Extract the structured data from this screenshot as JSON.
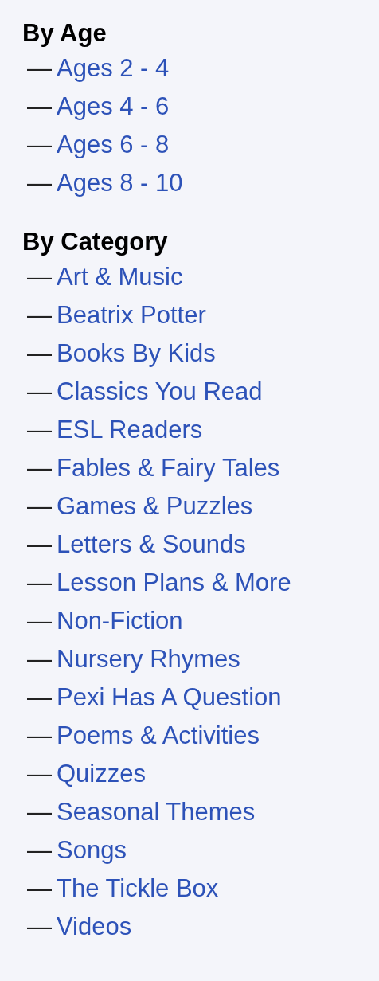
{
  "sections": [
    {
      "heading": "By Age",
      "items": [
        {
          "dash": "—",
          "label": "Ages 2 - 4"
        },
        {
          "dash": "—",
          "label": "Ages 4 - 6"
        },
        {
          "dash": "—",
          "label": "Ages 6 - 8"
        },
        {
          "dash": "—",
          "label": "Ages 8 - 10"
        }
      ]
    },
    {
      "heading": "By Category",
      "items": [
        {
          "dash": "—",
          "label": "Art & Music"
        },
        {
          "dash": "—",
          "label": "Beatrix Potter"
        },
        {
          "dash": "—",
          "label": "Books By Kids"
        },
        {
          "dash": "—",
          "label": "Classics You Read"
        },
        {
          "dash": "—",
          "label": "ESL Readers"
        },
        {
          "dash": "—",
          "label": "Fables & Fairy Tales"
        },
        {
          "dash": "—",
          "label": "Games & Puzzles"
        },
        {
          "dash": "—",
          "label": "Letters & Sounds"
        },
        {
          "dash": "—",
          "label": "Lesson Plans & More"
        },
        {
          "dash": "—",
          "label": "Non-Fiction"
        },
        {
          "dash": "—",
          "label": "Nursery Rhymes"
        },
        {
          "dash": "—",
          "label": "Pexi Has A Question"
        },
        {
          "dash": "—",
          "label": "Poems & Activities"
        },
        {
          "dash": "—",
          "label": "Quizzes"
        },
        {
          "dash": "—",
          "label": "Seasonal Themes"
        },
        {
          "dash": "—",
          "label": "Songs"
        },
        {
          "dash": "—",
          "label": "The Tickle Box"
        },
        {
          "dash": "—",
          "label": "Videos"
        }
      ]
    }
  ]
}
